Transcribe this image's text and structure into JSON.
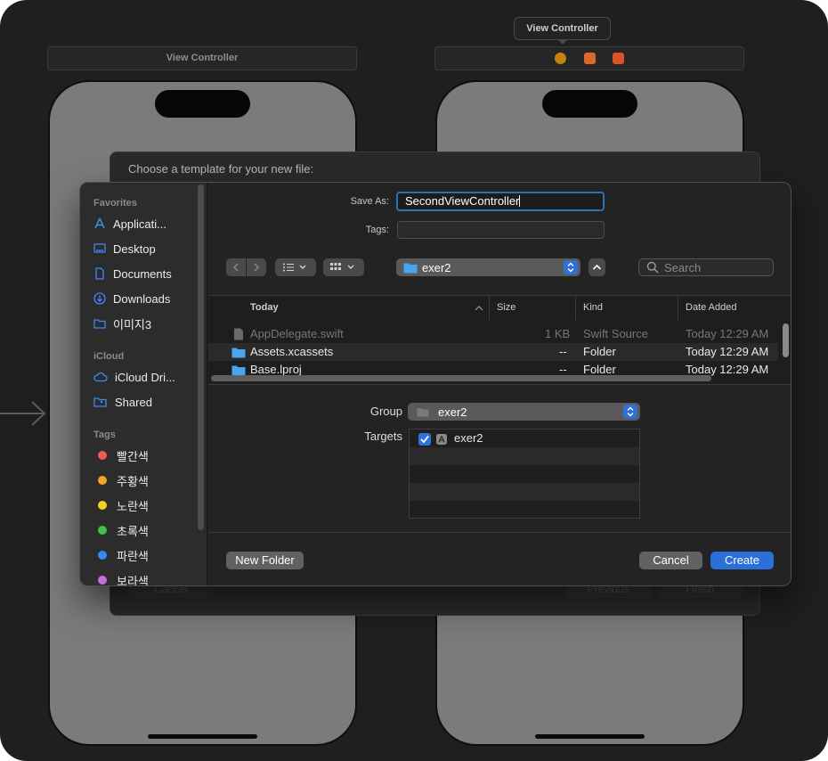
{
  "storyboard": {
    "left_scene_title": "View Controller",
    "right_scene_tooltip": "View Controller",
    "scene_icon_colors": [
      "#c5830e",
      "#d96a2b",
      "#d9542b"
    ]
  },
  "template_sheet": {
    "title": "Choose a template for your new file:",
    "cancel_label": "Cancel",
    "previous_label": "Previous",
    "finish_label": "Finish"
  },
  "dialog": {
    "save_as_label": "Save As:",
    "save_as_value": "SecondViewController",
    "tags_label": "Tags:",
    "location": "exer2",
    "search_placeholder": "Search",
    "sidebar": {
      "favorites_header": "Favorites",
      "favorites": [
        {
          "label": "Applicati...",
          "icon": "applications-icon"
        },
        {
          "label": "Desktop",
          "icon": "desktop-icon"
        },
        {
          "label": "Documents",
          "icon": "document-icon"
        },
        {
          "label": "Downloads",
          "icon": "downloads-icon"
        },
        {
          "label": "이미지3",
          "icon": "folder-icon"
        }
      ],
      "icloud_header": "iCloud",
      "icloud": [
        {
          "label": "iCloud Dri...",
          "icon": "cloud-icon"
        },
        {
          "label": "Shared",
          "icon": "shared-folder-icon"
        }
      ],
      "tags_header": "Tags",
      "tags": [
        {
          "label": "빨간색",
          "color": "#ec5b55"
        },
        {
          "label": "주황색",
          "color": "#f2a32a"
        },
        {
          "label": "노란색",
          "color": "#f4d21f"
        },
        {
          "label": "초록색",
          "color": "#40c24f"
        },
        {
          "label": "파란색",
          "color": "#2f8cf0"
        },
        {
          "label": "보라색",
          "color": "#c66fd9"
        }
      ]
    },
    "columns": {
      "name": "Today",
      "size": "Size",
      "kind": "Kind",
      "date": "Date Added"
    },
    "files": [
      {
        "name": "AppDelegate.swift",
        "size": "1 KB",
        "kind": "Swift Source",
        "date": "Today 12:29 AM"
      },
      {
        "name": "Assets.xcassets",
        "size": "--",
        "kind": "Folder",
        "date": "Today 12:29 AM"
      },
      {
        "name": "Base.lproj",
        "size": "--",
        "kind": "Folder",
        "date": "Today 12:29 AM"
      }
    ],
    "group_label": "Group",
    "group_value": "exer2",
    "targets_label": "Targets",
    "target": {
      "name": "exer2",
      "checked": true
    },
    "new_folder_label": "New Folder",
    "cancel_label": "Cancel",
    "create_label": "Create"
  }
}
